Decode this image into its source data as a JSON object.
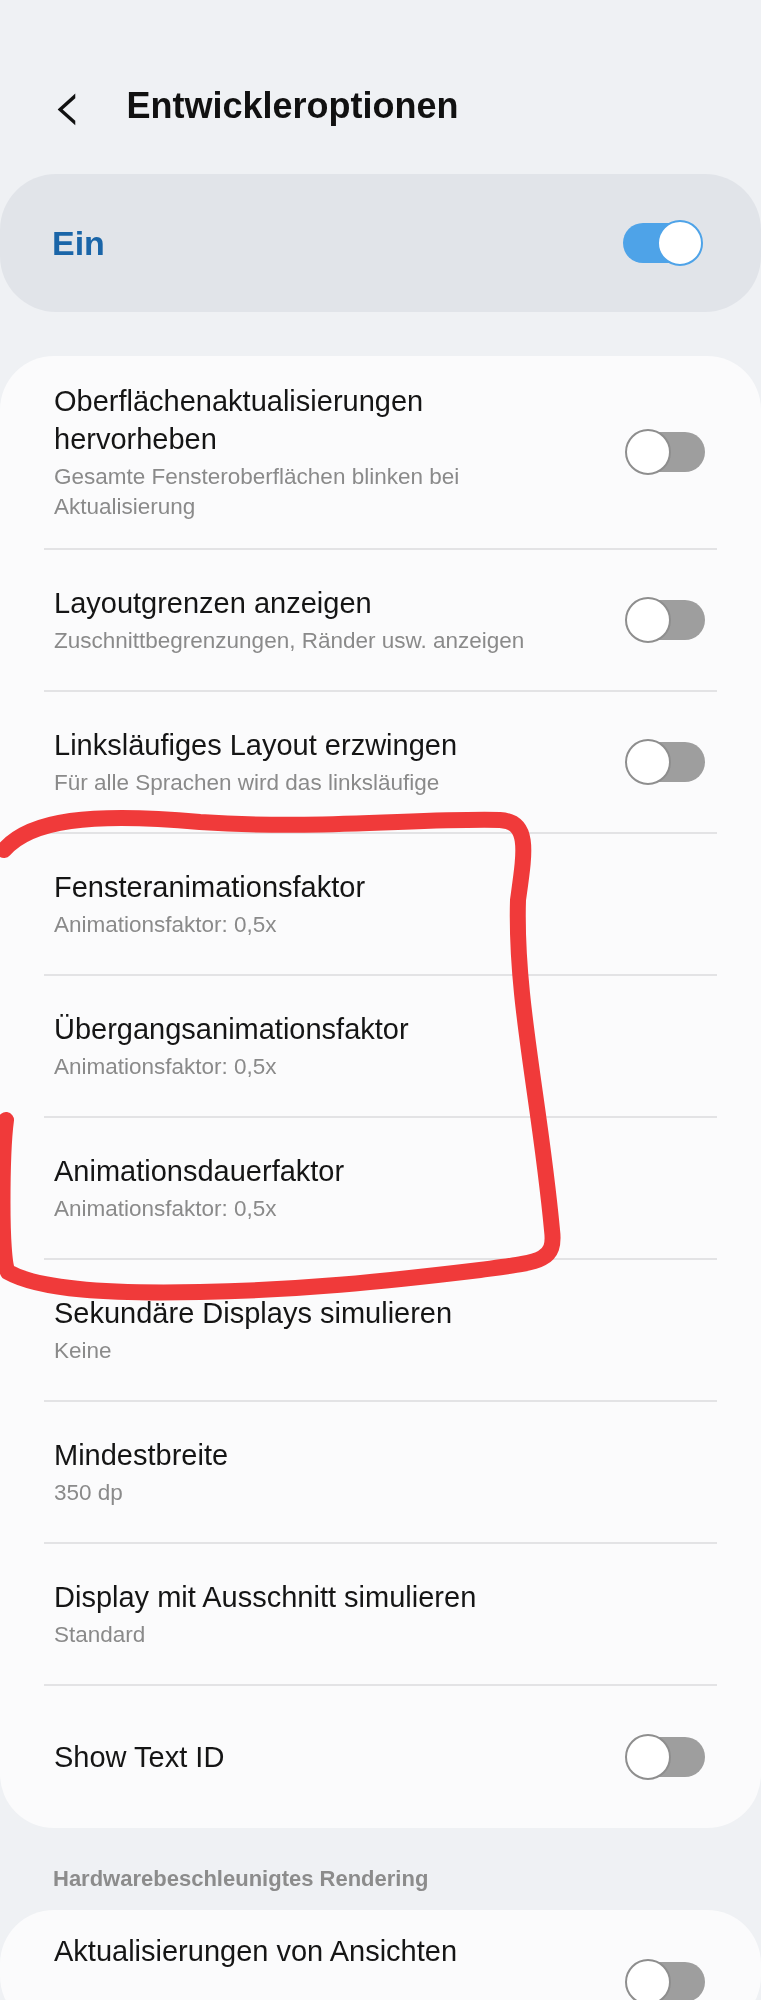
{
  "header": {
    "back": "‹",
    "title": "Entwickleroptionen"
  },
  "master": {
    "label": "Ein",
    "on": true
  },
  "groups": [
    {
      "rows": [
        {
          "kind": "toggle",
          "title": "Oberflächenaktualisierungen hervorheben",
          "subtitle": "Gesamte Fensteroberflächen blinken bei Aktualisierung",
          "on": false
        },
        {
          "kind": "toggle",
          "title": "Layoutgrenzen anzeigen",
          "subtitle": "Zuschnittbegrenzungen, Ränder usw. anzeigen",
          "on": false
        },
        {
          "kind": "toggle",
          "title": "Linksläufiges Layout erzwingen",
          "subtitle": "Für alle Sprachen wird das linksläufige",
          "on": false
        },
        {
          "kind": "value",
          "title": "Fensteranimationsfaktor",
          "subtitle": "Animationsfaktor: 0,5x"
        },
        {
          "kind": "value",
          "title": "Übergangsanimationsfaktor",
          "subtitle": "Animationsfaktor: 0,5x"
        },
        {
          "kind": "value",
          "title": "Animationsdauerfaktor",
          "subtitle": "Animationsfaktor: 0,5x"
        },
        {
          "kind": "value",
          "title": "Sekundäre Displays simulieren",
          "subtitle": "Keine"
        },
        {
          "kind": "value",
          "title": "Mindestbreite",
          "subtitle": "350 dp"
        },
        {
          "kind": "value",
          "title": "Display mit Ausschnitt simulieren",
          "subtitle": "Standard"
        },
        {
          "kind": "toggle",
          "title": "Show Text ID",
          "on": false
        }
      ]
    },
    {
      "heading": "Hardwarebeschleunigtes Rendering",
      "rows": [
        {
          "kind": "toggle",
          "title": "Aktualisierungen von Ansichten",
          "on": false
        }
      ]
    }
  ],
  "annotation": {
    "kind": "loop"
  }
}
